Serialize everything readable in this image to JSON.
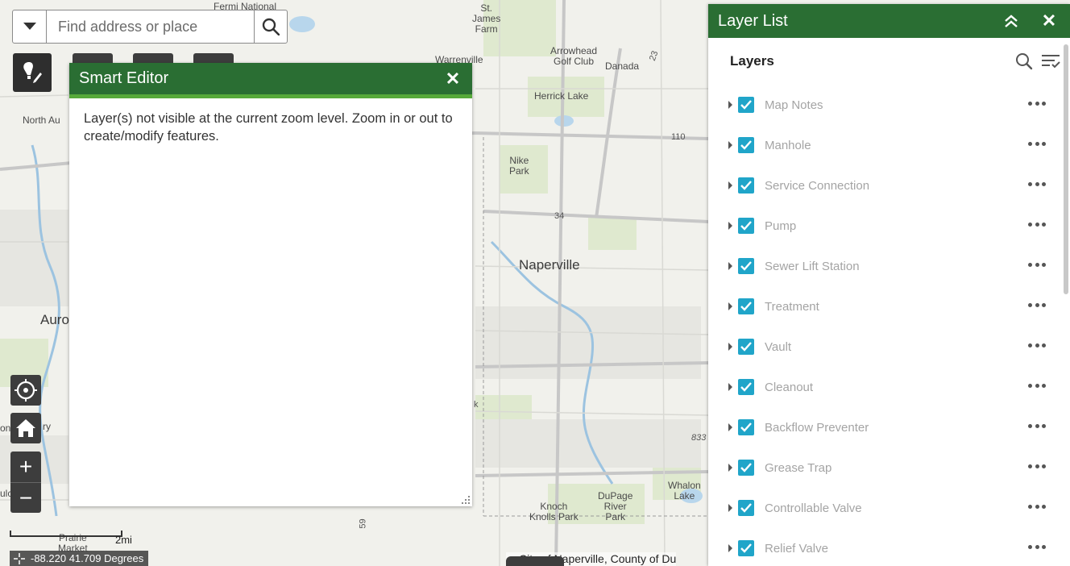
{
  "search": {
    "placeholder": "Find address or place",
    "dropdown_icon": "caret-down-icon",
    "search_icon": "search-icon"
  },
  "map": {
    "labels": [
      {
        "text": "Fermi National",
        "kind": "normal"
      },
      {
        "text": "St.\nJames\nFarm",
        "kind": "normal"
      },
      {
        "text": "Warrenville",
        "kind": "normal"
      },
      {
        "text": "Arrowhead\nGolf Club",
        "kind": "normal"
      },
      {
        "text": "Danada",
        "kind": "normal"
      },
      {
        "text": "Herrick Lake",
        "kind": "normal"
      },
      {
        "text": "North Au",
        "kind": "normal"
      },
      {
        "text": "Nike\nPark",
        "kind": "normal"
      },
      {
        "text": "Naperville",
        "kind": "city"
      },
      {
        "text": "Auro",
        "kind": "city"
      },
      {
        "text": "Knoch\nKnolls Park",
        "kind": "normal"
      },
      {
        "text": "DuPage\nRiver\nPark",
        "kind": "normal"
      },
      {
        "text": "Whalon\nLake",
        "kind": "normal"
      },
      {
        "text": "Prairie\nMarket",
        "kind": "normal"
      },
      {
        "text": "on",
        "kind": "normal"
      },
      {
        "text": "ry",
        "kind": "normal"
      },
      {
        "text": "ulc",
        "kind": "normal"
      },
      {
        "text": "23",
        "kind": "road"
      },
      {
        "text": "110",
        "kind": "road"
      },
      {
        "text": "34",
        "kind": "road"
      },
      {
        "text": "833",
        "kind": "road"
      },
      {
        "text": "59",
        "kind": "road"
      },
      {
        "text": "k",
        "kind": "road"
      }
    ],
    "scale_label": "2mi",
    "coordinates": "-88.220 41.709 Degrees",
    "attribution": "City of Naperville, County of Du"
  },
  "tools": {
    "smart_editor_icon": "smart-editor-icon",
    "locate_icon": "locate-icon",
    "home_icon": "home-icon",
    "zoom_in": "+",
    "zoom_out": "−"
  },
  "smart_editor": {
    "title": "Smart Editor",
    "close": "✕",
    "message": "Layer(s) not visible at the current zoom level. Zoom in or out to create/modify features."
  },
  "layer_list": {
    "title": "Layer List",
    "collapse_icon": "double-chevron-up-icon",
    "close": "✕",
    "subtitle": "Layers",
    "search_icon": "search-icon",
    "filter_icon": "filter-list-icon",
    "layers": [
      {
        "label": "Map Notes",
        "checked": true
      },
      {
        "label": "Manhole",
        "checked": true
      },
      {
        "label": "Service Connection",
        "checked": true
      },
      {
        "label": "Pump",
        "checked": true
      },
      {
        "label": "Sewer Lift Station",
        "checked": true
      },
      {
        "label": "Treatment",
        "checked": true
      },
      {
        "label": "Vault",
        "checked": true
      },
      {
        "label": "Cleanout",
        "checked": true
      },
      {
        "label": "Backflow Preventer",
        "checked": true
      },
      {
        "label": "Grease Trap",
        "checked": true
      },
      {
        "label": "Controllable Valve",
        "checked": true
      },
      {
        "label": "Relief Valve",
        "checked": true
      }
    ]
  },
  "colors": {
    "header_green": "#2a6e33",
    "accent_green": "#56a93a",
    "checkbox_blue": "#20a5c9"
  }
}
